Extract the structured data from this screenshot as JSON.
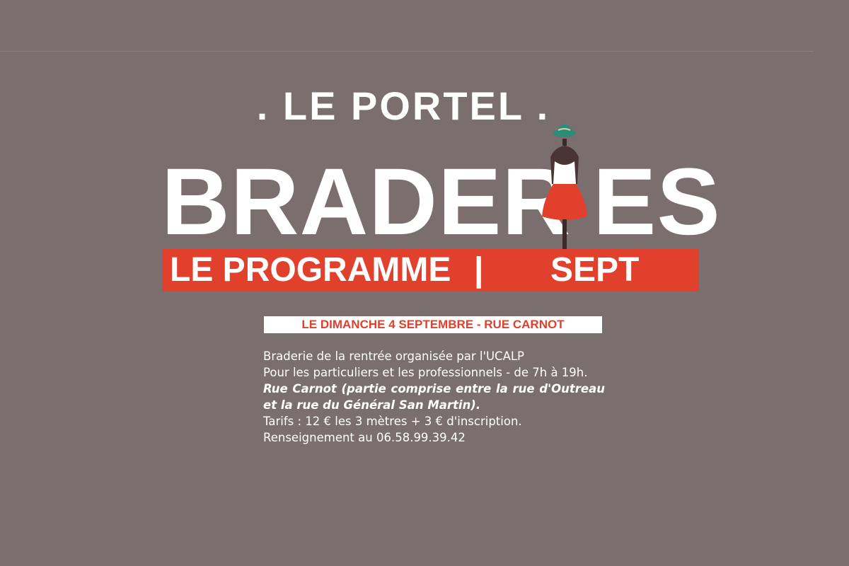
{
  "header": {
    "town": ". LE PORTEL ."
  },
  "title": {
    "left": "BRADER",
    "right": "ES"
  },
  "banner": {
    "left": "LE PROGRAMME",
    "separator": "|",
    "right": "SEPT",
    "color": "#e1402c"
  },
  "event": {
    "date_label": "LE DIMANCHE 4 SEPTEMBRE - RUE CARNOT",
    "line1": "Braderie de la rentrée organisée par l'UCALP",
    "line2": "Pour les particuliers et les professionnels - de 7h à 19h.",
    "location": "Rue Carnot (partie comprise entre la rue d'Outreau et la rue du Général San Martin).",
    "prices": "Tarifs : 12 € les 3 mètres + 3 € d'inscription.",
    "contact": "Renseignement au 06.58.99.39.42"
  },
  "colors": {
    "background": "#7b6e6e",
    "accent": "#e1402c",
    "hat": "#2f8a7a"
  },
  "illustration": {
    "name": "mannequin-dress-icon"
  }
}
